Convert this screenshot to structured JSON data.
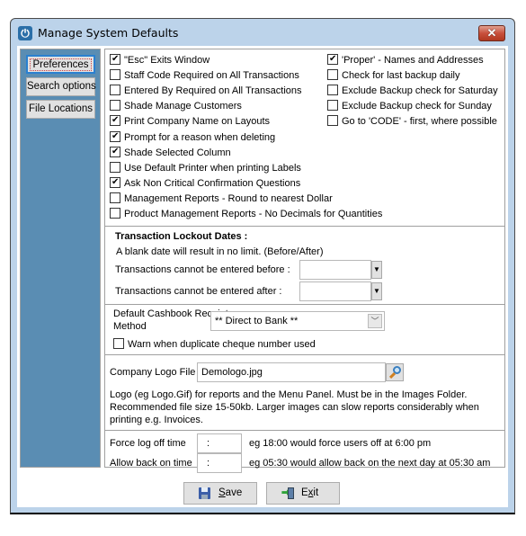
{
  "window": {
    "title": "Manage System Defaults",
    "close_label": "✕"
  },
  "sidebar": {
    "items": [
      {
        "label": "Preferences",
        "active": true
      },
      {
        "label": "Search options",
        "active": false
      },
      {
        "label": "File Locations",
        "active": false
      }
    ]
  },
  "preferences": {
    "left_options": [
      {
        "label": "\"Esc\" Exits Window",
        "checked": true
      },
      {
        "label": "Staff Code Required on All Transactions",
        "checked": false
      },
      {
        "label": "Entered By Required on All Transactions",
        "checked": false
      },
      {
        "label": "Shade Manage Customers",
        "checked": false
      },
      {
        "label": "Print Company Name on Layouts",
        "checked": true
      },
      {
        "label": "Prompt for a reason when deleting",
        "checked": true
      },
      {
        "label": "Shade Selected Column",
        "checked": true
      },
      {
        "label": "Use Default Printer when printing Labels",
        "checked": false
      },
      {
        "label": "Ask Non Critical Confirmation Questions",
        "checked": true
      },
      {
        "label": "Management Reports -  Round to nearest Dollar",
        "checked": false
      },
      {
        "label": "Product Management Reports - No Decimals for Quantities",
        "checked": false
      }
    ],
    "right_options": [
      {
        "label": "'Proper' - Names and Addresses",
        "checked": true
      },
      {
        "label": "Check for last backup daily",
        "checked": false
      },
      {
        "label": "Exclude Backup check for Saturday",
        "checked": false
      },
      {
        "label": "Exclude Backup check for Sunday",
        "checked": false
      },
      {
        "label": "Go to 'CODE' - first, where possible",
        "checked": false
      }
    ]
  },
  "lockout": {
    "heading": "Transaction Lockout Dates :",
    "note": "A blank date will result in no limit. (Before/After)",
    "before_label": "Transactions cannot be entered before :",
    "before_value": "",
    "after_label": "Transactions cannot be entered after :",
    "after_value": ""
  },
  "cashbook": {
    "label_line1": "Default Cashbook Receipt",
    "label_line2": "Method",
    "selected": "** Direct to Bank **",
    "warn_label": "Warn when duplicate cheque number used",
    "warn_checked": false
  },
  "logo": {
    "label": "Company Logo File",
    "value": "Demologo.jpg",
    "description_lines": [
      "Logo (eg Logo.Gif) for reports and the Menu Panel. Must be in the Images Folder.",
      "Recommended file size 15-50kb. Larger images can slow reports considerably when",
      "printing e.g. Invoices."
    ]
  },
  "logoff": {
    "force_label": "Force log off time",
    "force_value": ":",
    "force_hint": "eg  18:00  would force users off at 6:00 pm",
    "allow_label": "Allow back on time",
    "allow_value": ":",
    "allow_hint": "eg  05:30  would allow back on the next day at 05:30 am"
  },
  "buttons": {
    "save_first": "S",
    "save_rest": "ave",
    "exit_first": "E",
    "exit_mid": "x",
    "exit_rest": "it"
  }
}
